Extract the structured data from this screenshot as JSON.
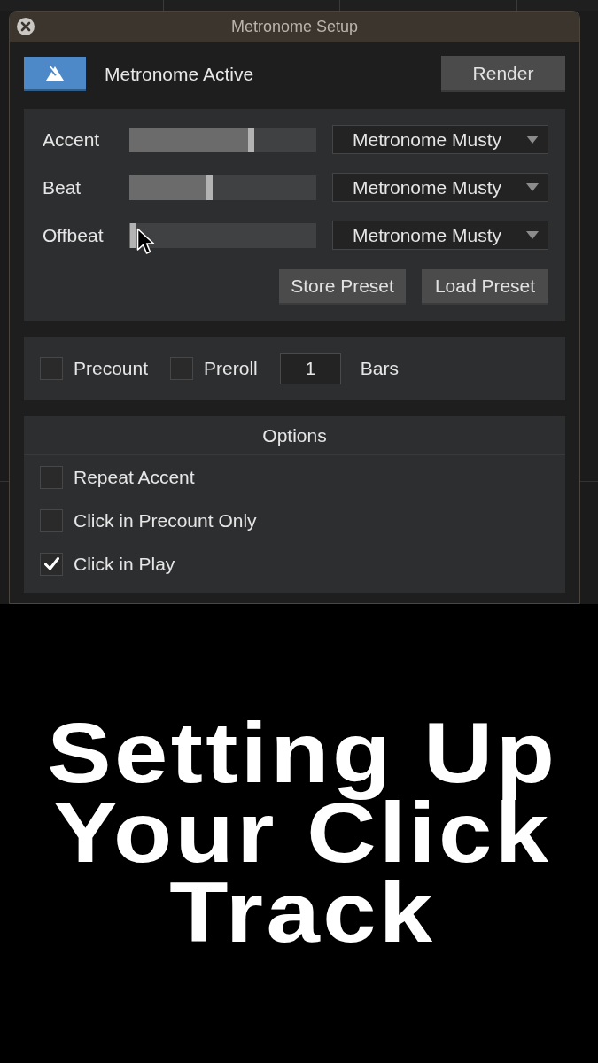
{
  "window": {
    "title": "Metronome Setup"
  },
  "toolbar": {
    "metronome_toggle": {
      "label": "Metronome Active",
      "on": true
    },
    "render_button": "Render"
  },
  "sounds": [
    {
      "label": "Accent",
      "level": 0.65,
      "sound": "Metronome Musty"
    },
    {
      "label": "Beat",
      "level": 0.43,
      "sound": "Metronome Musty"
    },
    {
      "label": "Offbeat",
      "level": 0.02,
      "sound": "Metronome Musty"
    }
  ],
  "preset_buttons": [
    "Store Preset",
    "Load Preset"
  ],
  "count_in": {
    "checkboxes": [
      {
        "label": "Precount",
        "checked": false
      },
      {
        "label": "Preroll",
        "checked": false
      }
    ],
    "bars_value": "1",
    "bars_label": "Bars"
  },
  "options": {
    "title": "Options",
    "items": [
      {
        "label": "Repeat Accent",
        "checked": false
      },
      {
        "label": "Click in Precount Only",
        "checked": false
      },
      {
        "label": "Click in Play",
        "checked": true
      }
    ]
  },
  "caption": {
    "lines": [
      "Setting Up",
      "Your Click",
      "Track"
    ]
  }
}
